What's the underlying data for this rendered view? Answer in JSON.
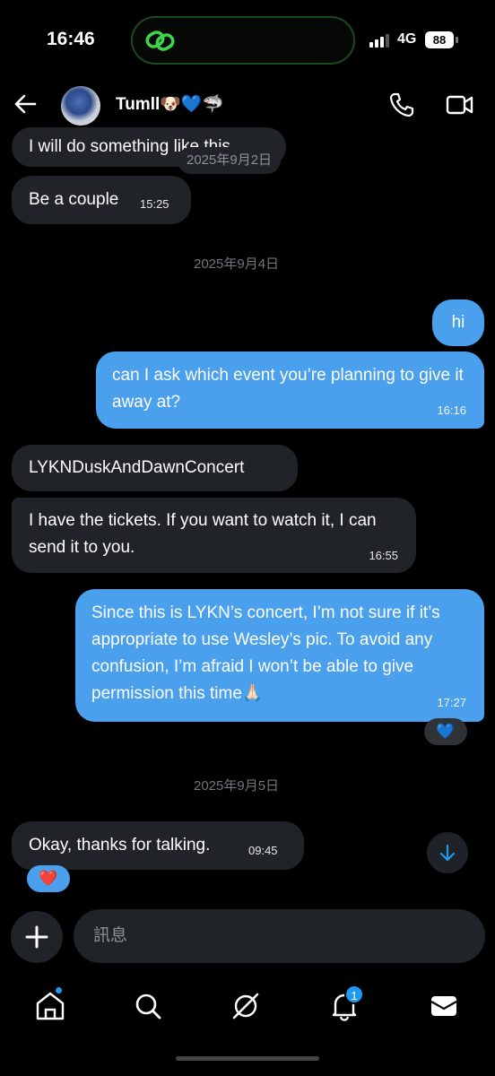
{
  "status": {
    "time": "16:46",
    "network": "4G",
    "battery": "88"
  },
  "header": {
    "contact_name": "Tumll🐶💙🦈"
  },
  "messages": {
    "m1_text": "I will do something like this",
    "date1": "2025年9月2日",
    "m2_text": "Be a couple",
    "m2_time": "15:25",
    "date2": "2025年9月4日",
    "m3_text": "hi",
    "m4_text": "can I ask which event you’re planning to give it away at?",
    "m4_time": "16:16",
    "m5_text": "LYKNDuskAndDawnConcert",
    "m6_text": "I have the tickets. If you want to watch it, I can send it to you.",
    "m6_time": "16:55",
    "m7_text": "Since this is LYKN’s concert, I’m not sure if it’s appropriate to use Wesley’s pic. To avoid any confusion, I’m afraid I won’t be able to give permission this time🙏🏻",
    "m7_time": "17:27",
    "m7_reaction": "💙",
    "date3": "2025年9月5日",
    "m8_text": "Okay, thanks for talking.",
    "m8_time": "09:45",
    "m8_reaction": "❤️"
  },
  "composer": {
    "placeholder": "訊息"
  },
  "nav": {
    "notifications_badge": "1"
  },
  "colors": {
    "background": "#000000",
    "incoming_bubble": "#202327",
    "outgoing_bubble": "#4aa0ec",
    "accent": "#1d9bf0"
  }
}
